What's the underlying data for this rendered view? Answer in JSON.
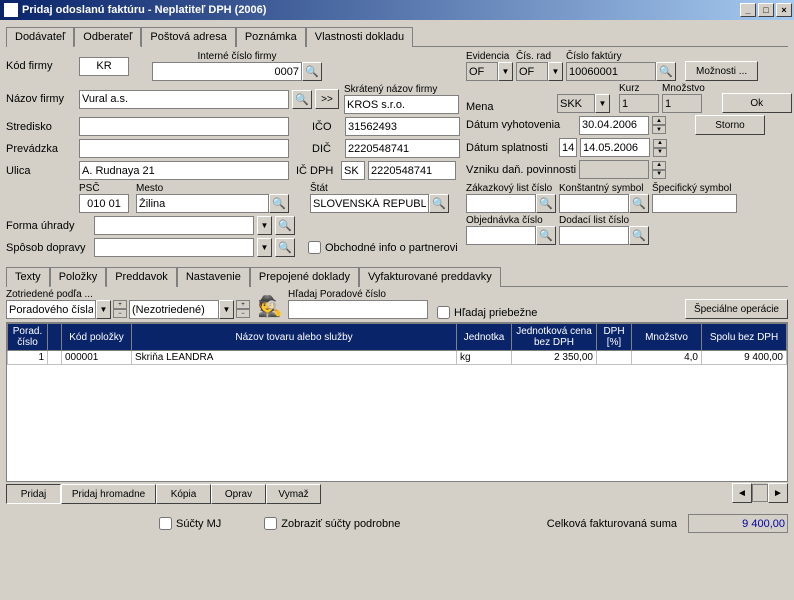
{
  "window": {
    "title": "Pridaj odoslanú faktúru - Neplatiteľ DPH (2006)"
  },
  "tabs_top": [
    "Dodávateľ",
    "Odberateľ",
    "Poštová adresa",
    "Poznámka",
    "Vlastnosti dokladu"
  ],
  "tabs_top_active": 1,
  "labels": {
    "kod_firmy": "Kód firmy",
    "interne_cislo": "Interné číslo firmy",
    "nazov_firmy": "Názov firmy",
    "skrateny": "Skrátený názov firmy",
    "stredisko": "Stredisko",
    "ico": "IČO",
    "prevadzka": "Prevádzka",
    "dic": "DIČ",
    "ulica": "Ulica",
    "icdph": "IČ DPH",
    "psc": "PSČ",
    "mesto": "Mesto",
    "stat": "Štát",
    "forma": "Forma úhrady",
    "sposob": "Spôsob dopravy",
    "obchodne": "Obchodné info o partnerovi",
    "evidencia": "Evidencia",
    "cisrad": "Čís. rad",
    "cislo_fakt": "Číslo faktúry",
    "moznosti": "Možnosti ...",
    "mena": "Mena",
    "kurz": "Kurz",
    "mnozstvo": "Množstvo",
    "ok": "Ok",
    "storno": "Storno",
    "datum_vyh": "Dátum vyhotovenia",
    "datum_spl": "Dátum splatnosti",
    "vznik": "Vzniku daň. povinnosti",
    "zakaz": "Zákazkový list číslo",
    "konst": "Konštantný symbol",
    "spec": "Špecifický symbol",
    "obj": "Objednávka číslo",
    "dodaci": "Dodací list číslo",
    "zotriedene": "Zotriedené podľa ...",
    "hladaj_porad": "Hľadaj Poradové číslo",
    "hladaj_prieb": "Hľadaj priebežne",
    "specialne": "Špeciálne operácie",
    "sucty_mj": "Súčty MJ",
    "zobrazit": "Zobraziť súčty podrobne",
    "celkova": "Celková fakturovaná suma"
  },
  "values": {
    "kod_firmy": "KR",
    "interne_cislo": "0007",
    "nazov_firmy": "Vural a.s.",
    "skrateny": "KROS s.r.o.",
    "ico": "31562493",
    "dic": "2220548741",
    "icdph_stat": "SK",
    "icdph": "2220548741",
    "ulica": "A. Rudnaya 21",
    "psc": "010 01",
    "mesto": "Žilina",
    "stat": "SLOVENSKÁ REPUBLI",
    "evidencia": "OF",
    "cisrad": "OF",
    "cislo_fakt": "10060001",
    "mena": "SKK",
    "kurz": "1",
    "mnozstvo": "1",
    "datum_vyh": "30.04.2006",
    "datum_spl_days": "14",
    "datum_spl": "14.05.2006",
    "sort1": "Poradového čísla",
    "sort2": "(Nezotriedené)",
    "celkova": "9 400,00"
  },
  "tabs_mid": [
    "Texty",
    "Položky",
    "Preddavok",
    "Nastavenie",
    "Prepojené doklady",
    "Vyfakturované preddavky"
  ],
  "tabs_mid_active": 1,
  "grid": {
    "cols": [
      "Porad. číslo",
      "",
      "Kód položky",
      "Názov tovaru alebo služby",
      "Jednotka",
      "Jednotková cena bez DPH",
      "DPH [%]",
      "Množstvo",
      "Spolu bez DPH"
    ],
    "rows": [
      {
        "porad": "1",
        "kod": "000001",
        "nazov": "Skriňa LEANDRA",
        "jednotka": "kg",
        "cena": "2 350,00",
        "dph": "",
        "mnoz": "4,0",
        "spolu": "9 400,00"
      }
    ]
  },
  "footer_btns": [
    "Pridaj",
    "Pridaj hromadne",
    "Kópia",
    "Oprav",
    "Vymaž"
  ],
  "arrow_btn": ">>"
}
